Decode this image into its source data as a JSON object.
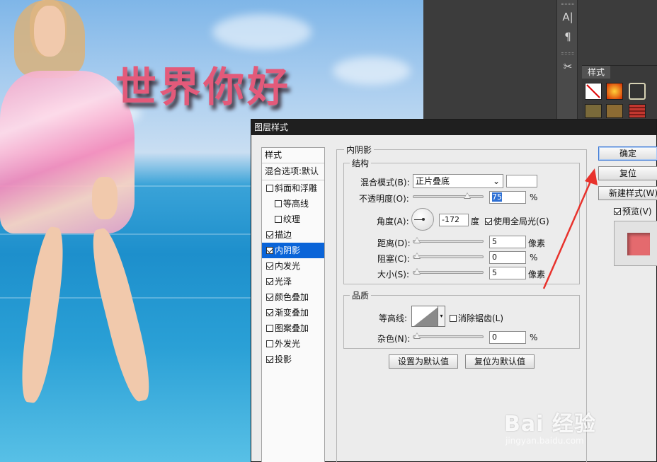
{
  "canvas": {
    "headline": "世界你好"
  },
  "ps_panel": {
    "styles_tab": "样式"
  },
  "dialog": {
    "title": "图层样式",
    "style_list": {
      "header": "样式",
      "blend_options": "混合选项:默认",
      "items": [
        {
          "label": "斜面和浮雕",
          "checked": false,
          "indent": false,
          "active": false
        },
        {
          "label": "等高线",
          "checked": false,
          "indent": true,
          "active": false
        },
        {
          "label": "纹理",
          "checked": false,
          "indent": true,
          "active": false
        },
        {
          "label": "描边",
          "checked": true,
          "indent": false,
          "active": false
        },
        {
          "label": "内阴影",
          "checked": true,
          "indent": false,
          "active": true
        },
        {
          "label": "内发光",
          "checked": true,
          "indent": false,
          "active": false
        },
        {
          "label": "光泽",
          "checked": true,
          "indent": false,
          "active": false
        },
        {
          "label": "颜色叠加",
          "checked": true,
          "indent": false,
          "active": false
        },
        {
          "label": "渐变叠加",
          "checked": true,
          "indent": false,
          "active": false
        },
        {
          "label": "图案叠加",
          "checked": false,
          "indent": false,
          "active": false
        },
        {
          "label": "外发光",
          "checked": false,
          "indent": false,
          "active": false
        },
        {
          "label": "投影",
          "checked": true,
          "indent": false,
          "active": false
        }
      ]
    },
    "inner_shadow": {
      "section_title": "内阴影",
      "structure": {
        "title": "结构",
        "blend_mode_label": "混合模式(B):",
        "blend_mode_value": "正片叠底",
        "shadow_color": "#ffffff",
        "opacity_label": "不透明度(O):",
        "opacity_value": "75",
        "percent": "%",
        "angle_label": "角度(A):",
        "angle_value": "-172",
        "degree_unit": "度",
        "global_light_label": "使用全局光(G)",
        "global_light_checked": true,
        "distance_label": "距离(D):",
        "distance_value": "5",
        "choke_label": "阻塞(C):",
        "choke_value": "0",
        "size_label": "大小(S):",
        "size_value": "5",
        "pixel_unit": "像素"
      },
      "quality": {
        "title": "品质",
        "contour_label": "等高线:",
        "anti_alias_label": "消除锯齿(L)",
        "anti_alias_checked": false,
        "noise_label": "杂色(N):",
        "noise_value": "0"
      },
      "make_default": "设置为默认值",
      "reset_default": "复位为默认值"
    },
    "buttons": {
      "ok": "确定",
      "reset": "复位",
      "new_style": "新建样式(W)...",
      "preview_label": "预览(V)",
      "preview_checked": true
    },
    "preview_color": "#e46a6e"
  },
  "watermark": {
    "main": "Bai 经验",
    "url": "jingyan.baidu.com"
  }
}
